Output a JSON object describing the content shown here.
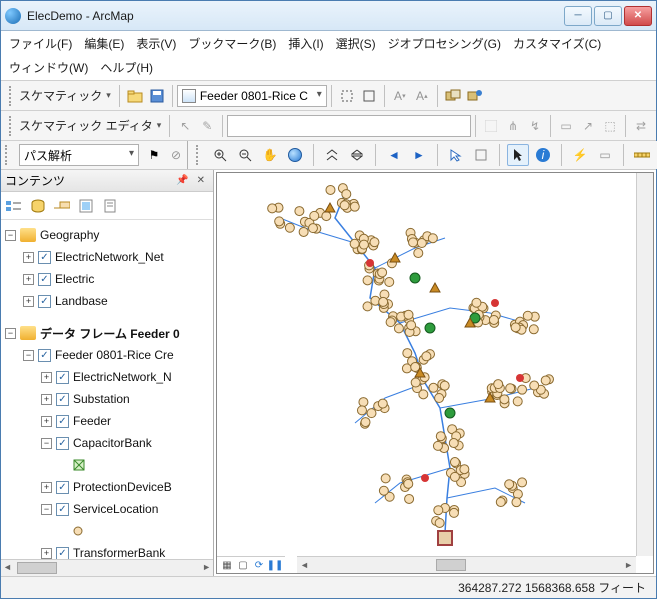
{
  "window": {
    "title": "ElecDemo - ArcMap"
  },
  "menu": {
    "file": "ファイル(F)",
    "edit": "編集(E)",
    "view": "表示(V)",
    "bookmark": "ブックマーク(B)",
    "insert": "挿入(I)",
    "select": "選択(S)",
    "geoproc": "ジオプロセシング(G)",
    "customize": "カスタマイズ(C)",
    "window": "ウィンドウ(W)",
    "help": "ヘルプ(H)"
  },
  "toolbar1": {
    "schematic_label": "スケマティック",
    "feeder_select": "Feeder 0801-Rice C"
  },
  "toolbar2": {
    "schematic_editor": "スケマティック エディタ"
  },
  "sidebar_top": {
    "path_analysis": "パス解析"
  },
  "contents": {
    "title": "コンテンツ",
    "df1": "Geography",
    "df1_layers": [
      "ElectricNetwork_Net",
      "Electric",
      "Landbase"
    ],
    "df2": "データ フレーム Feeder 0",
    "df2_root": "Feeder 0801-Rice Cre",
    "df2_layers": [
      "ElectricNetwork_N",
      "Substation",
      "Feeder",
      "CapacitorBank",
      "ProtectionDeviceB",
      "ServiceLocation",
      "TransformerBank"
    ]
  },
  "status": {
    "coords": "364287.272  1568368.658 フィート"
  },
  "chart_data": {
    "type": "network-diagram",
    "description": "Electric feeder schematic (Feeder 0801-Rice Creek). Tan circular nodes are service points connected by blue feeder lines, with scattered green capacitor banks, orange triangular protection devices, and red fault markers. A red-outlined square marks the substation at the bottom.",
    "node_count_approx": 160,
    "green_nodes_approx": 4,
    "triangle_nodes_approx": 6,
    "red_markers_approx": 4,
    "substation_at_bottom": true
  }
}
